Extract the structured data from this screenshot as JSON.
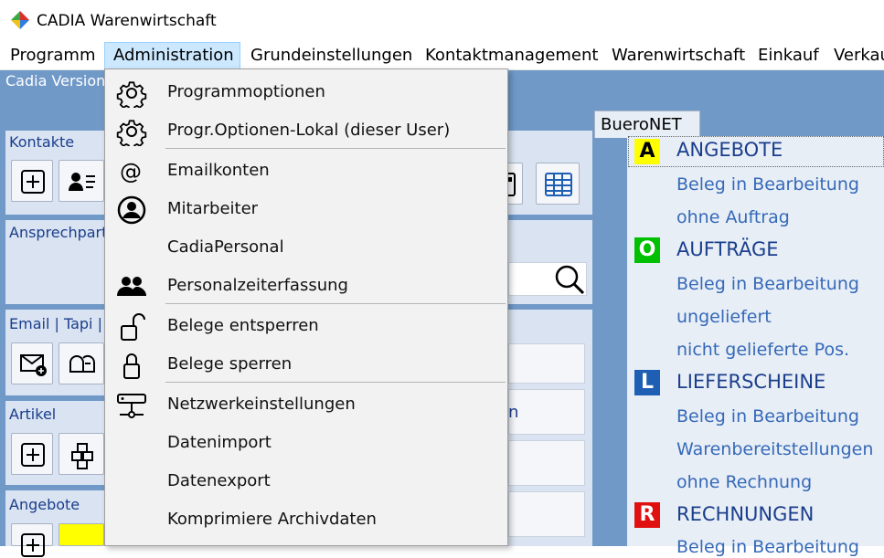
{
  "window": {
    "title": "CADIA Warenwirtschaft"
  },
  "menubar": {
    "items": [
      "Programm",
      "Administration",
      "Grundeinstellungen",
      "Kontaktmanagement",
      "Warenwirtschaft",
      "Einkauf",
      "Verkau"
    ]
  },
  "main": {
    "version_text": "Cadia Version",
    "panels": {
      "kontakte": "Kontakte",
      "ansprechpartner": "Ansprechpartn",
      "email_tapi": "Email | Tapi  |",
      "artikel": "Artikel",
      "angebote": "Angebote",
      "partial_text": "n"
    }
  },
  "dropdown": {
    "items": [
      {
        "label": "Programmoptionen",
        "icon": "gear-icon"
      },
      {
        "label": "Progr.Optionen-Lokal (dieser User)",
        "icon": "gear-icon"
      },
      {
        "label": "Emailkonten",
        "icon": "at-sign-icon"
      },
      {
        "label": "Mitarbeiter",
        "icon": "user-circle-icon"
      },
      {
        "label": "CadiaPersonal",
        "icon": ""
      },
      {
        "label": "Personalzeiterfassung",
        "icon": "people-icon"
      },
      {
        "label": "Belege entsperren",
        "icon": "unlock-icon"
      },
      {
        "label": "Belege sperren",
        "icon": "lock-icon"
      },
      {
        "label": "Netzwerkeinstellungen",
        "icon": "network-icon"
      },
      {
        "label": "Datenimport",
        "icon": ""
      },
      {
        "label": "Datenexport",
        "icon": ""
      },
      {
        "label": "Komprimiere Archivdaten",
        "icon": ""
      }
    ]
  },
  "bueronet": {
    "tab_label": "BueroNET",
    "sections": [
      {
        "badge": "A",
        "badge_color": "#ffff00",
        "badge_text_color": "#000000",
        "title": "ANGEBOTE",
        "links": [
          "Beleg in Bearbeitung",
          "ohne Auftrag"
        ]
      },
      {
        "badge": "O",
        "badge_color": "#00c000",
        "badge_text_color": "#ffffff",
        "title": "AUFTRÄGE",
        "links": [
          "Beleg in Bearbeitung",
          "ungeliefert",
          "nicht gelieferte Pos."
        ]
      },
      {
        "badge": "L",
        "badge_color": "#1e5fb4",
        "badge_text_color": "#ffffff",
        "title": "LIEFERSCHEINE",
        "links": [
          "Beleg in Bearbeitung",
          "Warenbereitstellungen",
          "ohne Rechnung"
        ]
      },
      {
        "badge": "R",
        "badge_color": "#e01010",
        "badge_text_color": "#ffffff",
        "title": "RECHNUNGEN",
        "links": [
          "Beleg in Bearbeitung"
        ]
      }
    ]
  },
  "colors": {
    "menu_highlight": "#cce8ff",
    "main_blue": "#7099c8",
    "link_blue": "#3569b8"
  }
}
